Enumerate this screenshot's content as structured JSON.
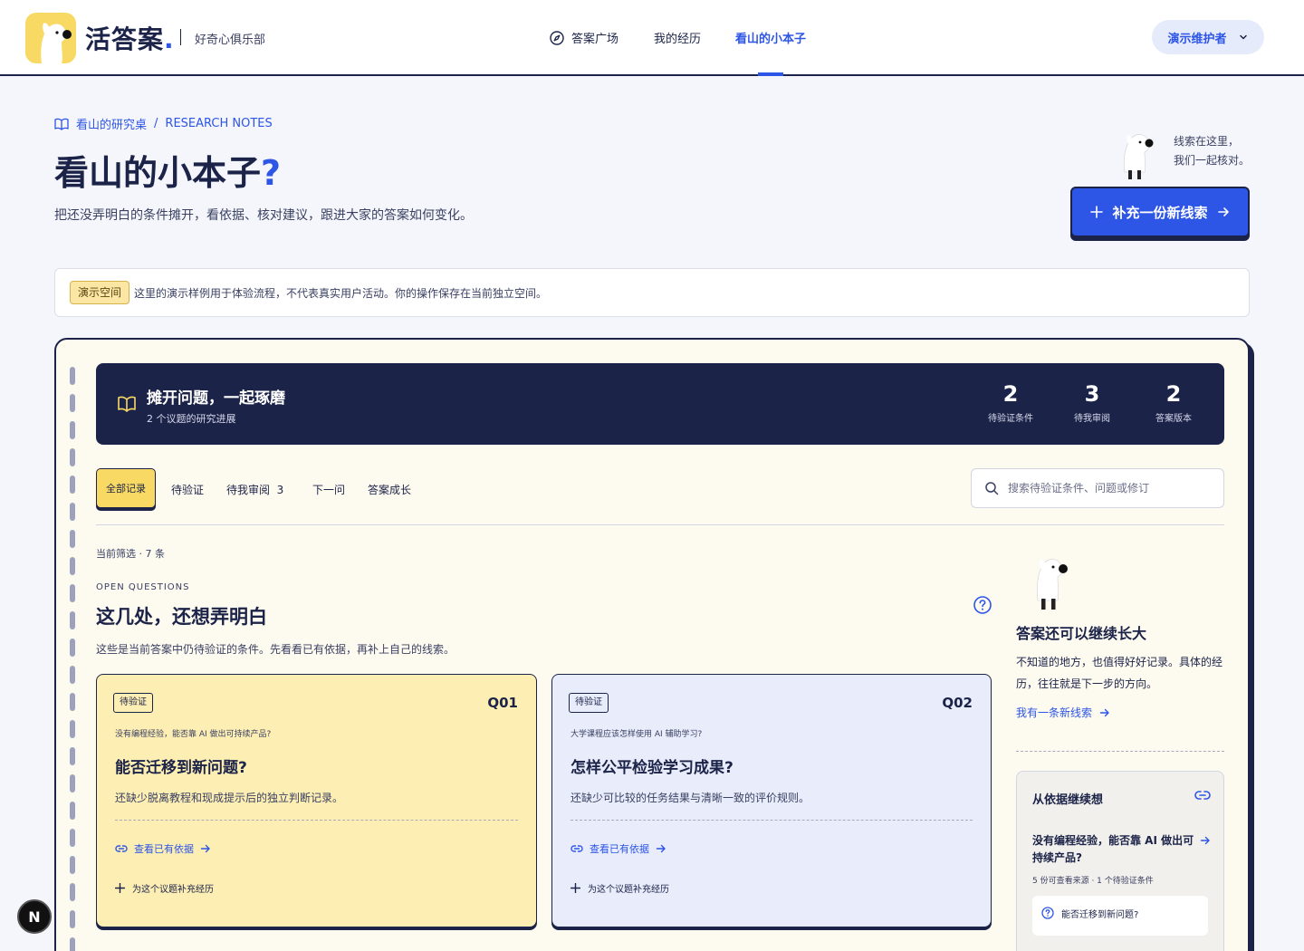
{
  "brand": {
    "name": "活答案",
    "dot": ".",
    "subtitle": "好奇心俱乐部"
  },
  "nav": {
    "items": [
      {
        "label": "答案广场",
        "icon": "compass-icon"
      },
      {
        "label": "我的经历"
      },
      {
        "label": "看山的小本子",
        "active": true
      }
    ],
    "user": "演示维护者"
  },
  "header": {
    "breadcrumb": "看山的研究桌",
    "breadcrumb_sep": "/",
    "breadcrumb_en": "RESEARCH NOTES",
    "title": "看山的小本子",
    "title_mark": "?",
    "description": "把还没弄明白的条件摊开，看依据、核对建议，跟进大家的答案如何变化。",
    "mascot_note_1": "线索在这里，",
    "mascot_note_2": "我们一起核对。",
    "cta_label": "补充一份新线索"
  },
  "notice": {
    "tag": "演示空间",
    "text": "这里的演示样例用于体验流程，不代表真实用户活动。你的操作保存在当前独立空间。"
  },
  "banner": {
    "title": "摊开问题，一起琢磨",
    "subtitle": "2 个议题的研究进展",
    "stats": [
      {
        "value": "2",
        "label": "待验证条件"
      },
      {
        "value": "3",
        "label": "待我审阅"
      },
      {
        "value": "2",
        "label": "答案版本"
      }
    ]
  },
  "tabs": {
    "all": "全部记录",
    "pending": "待验证",
    "review": "待我审阅",
    "review_count": "3",
    "next": "下一问",
    "growth": "答案成长"
  },
  "search": {
    "placeholder": "搜索待验证条件、问题或修订"
  },
  "section": {
    "filter": "当前筛选 · 7 条",
    "eyebrow": "OPEN QUESTIONS",
    "title": "这几处，还想弄明白",
    "description": "这些是当前答案中仍待验证的条件。先看看已有依据，再补上自己的线索。"
  },
  "questions": [
    {
      "tag": "待验证",
      "id": "Q01",
      "context": "没有编程经验，能否靠 AI 做出可持续产品?",
      "title": "能否迁移到新问题?",
      "desc": "还缺少脱离教程和现成提示后的独立判断记录。",
      "evidence": "查看已有依据",
      "add": "为这个议题补充经历"
    },
    {
      "tag": "待验证",
      "id": "Q02",
      "context": "大学课程应该怎样使用 AI 辅助学习?",
      "title": "怎样公平检验学习成果?",
      "desc": "还缺少可比较的任务结果与清晰一致的评价规则。",
      "evidence": "查看已有依据",
      "add": "为这个议题补充经历"
    }
  ],
  "side": {
    "title": "答案还可以继续长大",
    "desc": "不知道的地方，也值得好好记录。具体的经历，往往就是下一步的方向。",
    "link": "我有一条新线索",
    "card": {
      "title": "从依据继续想",
      "question": "没有编程经验，能否靠 AI 做出可持续产品?",
      "meta": "5 份可查看来源 · 1 个待验证条件",
      "chip": "能否迁移到新问题?"
    }
  },
  "fab": "N",
  "colors": {
    "navy": "#1c2348",
    "accent": "#2d55e6",
    "yellow": "#f7d964",
    "card_yellow": "#fdeeb3",
    "card_blue": "#e8ecfb",
    "paper": "#fdfaf0"
  }
}
